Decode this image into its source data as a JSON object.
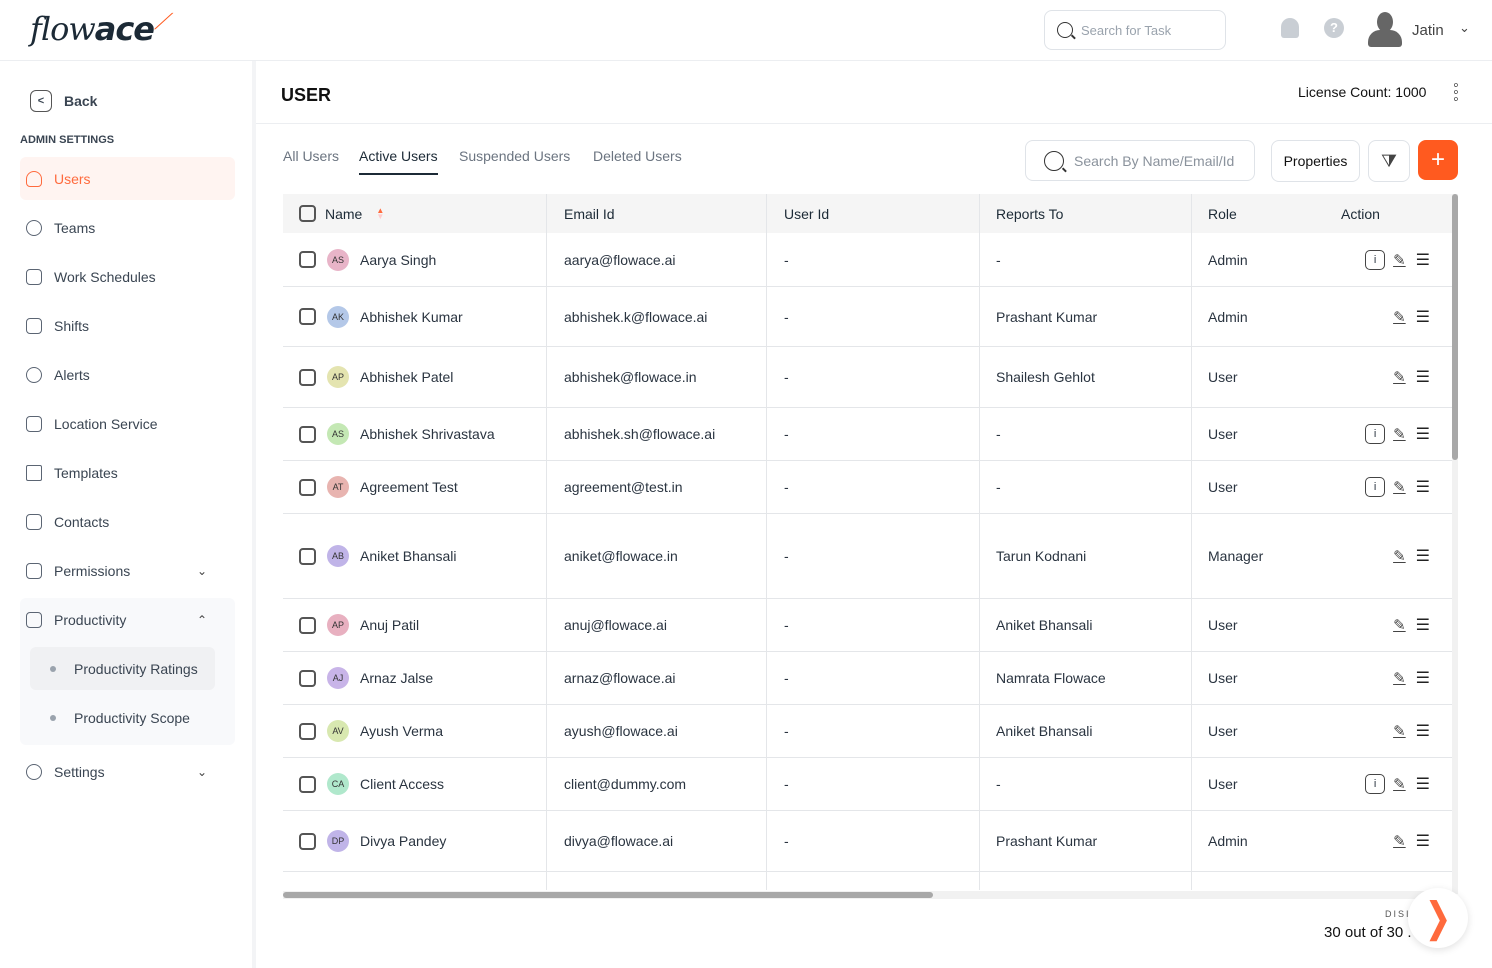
{
  "brand": {
    "logo": "flowace",
    "accent": "#ff5a1f"
  },
  "topbar": {
    "search_placeholder": "Search for Task",
    "user_name": "Jatin"
  },
  "sidebar": {
    "back": "Back",
    "section": "ADMIN SETTINGS",
    "items": [
      {
        "label": "Users",
        "icon": "user-icon",
        "active": true
      },
      {
        "label": "Teams",
        "icon": "teams-icon"
      },
      {
        "label": "Work Schedules",
        "icon": "calendar-icon"
      },
      {
        "label": "Shifts",
        "icon": "shifts-icon"
      },
      {
        "label": "Alerts",
        "icon": "alert-icon"
      },
      {
        "label": "Location Service",
        "icon": "location-icon"
      },
      {
        "label": "Templates",
        "icon": "folder-icon"
      },
      {
        "label": "Contacts",
        "icon": "contacts-icon"
      },
      {
        "label": "Permissions",
        "icon": "lock-icon",
        "chevron": "down"
      },
      {
        "label": "Productivity",
        "icon": "productivity-icon",
        "chevron": "up",
        "children": [
          "Productivity Ratings",
          "Productivity Scope"
        ]
      },
      {
        "label": "Settings",
        "icon": "settings-icon",
        "chevron": "down"
      }
    ]
  },
  "main": {
    "title": "USER",
    "license": "License Count: 1000",
    "tabs": [
      {
        "label": "All Users"
      },
      {
        "label": "Active Users",
        "active": true
      },
      {
        "label": "Suspended Users"
      },
      {
        "label": "Deleted Users"
      }
    ],
    "search_placeholder": "Search By Name/Email/Id",
    "properties": "Properties",
    "add": "+",
    "columns": [
      "Name",
      "Email Id",
      "User Id",
      "Reports To",
      "Role",
      "Action"
    ],
    "rows": [
      {
        "initials": "AS",
        "color": "#e8b4c8",
        "name": "Aarya Singh",
        "email": "aarya@flowace.ai",
        "user_id": "-",
        "reports_to": "-",
        "role": "Admin",
        "info": true
      },
      {
        "initials": "AK",
        "color": "#b4c8e8",
        "name": "Abhishek Kumar",
        "email": "abhishek.k@flowace.ai",
        "user_id": "-",
        "reports_to": "Prashant Kumar",
        "role": "Admin",
        "info": false
      },
      {
        "initials": "AP",
        "color": "#e4e4b0",
        "name": "Abhishek Patel",
        "email": "abhishek@flowace.in",
        "user_id": "-",
        "reports_to": "Shailesh Gehlot",
        "role": "User",
        "info": false
      },
      {
        "initials": "AS",
        "color": "#c4e8b4",
        "name": "Abhishek Shrivastava",
        "email": "abhishek.sh@flowace.ai",
        "user_id": "-",
        "reports_to": "-",
        "role": "User",
        "info": true
      },
      {
        "initials": "AT",
        "color": "#e8b4b0",
        "name": "Agreement Test",
        "email": "agreement@test.in",
        "user_id": "-",
        "reports_to": "-",
        "role": "User",
        "info": true
      },
      {
        "initials": "AB",
        "color": "#c0b4e8",
        "name": "Aniket Bhansali",
        "email": "aniket@flowace.in",
        "user_id": "-",
        "reports_to": "Tarun Kodnani",
        "role": "Manager",
        "info": false
      },
      {
        "initials": "AP",
        "color": "#e8b0c0",
        "name": "Anuj Patil",
        "email": "anuj@flowace.ai",
        "user_id": "-",
        "reports_to": "Aniket Bhansali",
        "role": "User",
        "info": false
      },
      {
        "initials": "AJ",
        "color": "#c8b4e8",
        "name": "Arnaz Jalse",
        "email": "arnaz@flowace.ai",
        "user_id": "-",
        "reports_to": "Namrata Flowace",
        "role": "User",
        "info": false
      },
      {
        "initials": "AV",
        "color": "#d8e8b0",
        "name": "Ayush Verma",
        "email": "ayush@flowace.ai",
        "user_id": "-",
        "reports_to": "Aniket Bhansali",
        "role": "User",
        "info": false
      },
      {
        "initials": "CA",
        "color": "#b0e8cc",
        "name": "Client Access",
        "email": "client@dummy.com",
        "user_id": "-",
        "reports_to": "-",
        "role": "User",
        "info": true
      },
      {
        "initials": "DP",
        "color": "#c0b4e8",
        "name": "Divya Pandey",
        "email": "divya@flowace.ai",
        "user_id": "-",
        "reports_to": "Prashant Kumar",
        "role": "Admin",
        "info": false
      }
    ],
    "footer": {
      "label": "DISI",
      "count": "30 out of 30 ."
    }
  }
}
